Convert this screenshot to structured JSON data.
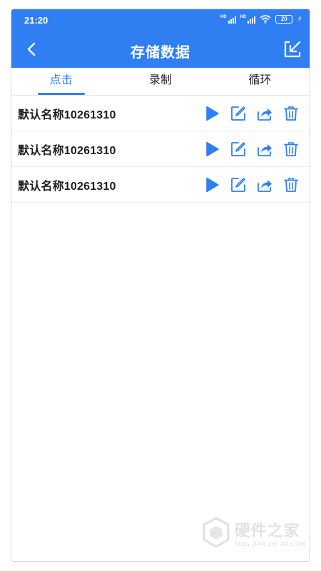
{
  "status_bar": {
    "time": "21:20",
    "battery": "20",
    "icons": [
      "hd-signal-icon",
      "hd-signal-icon",
      "wifi-icon",
      "battery-icon",
      "charging-icon"
    ]
  },
  "header": {
    "title": "存储数据",
    "back_icon": "chevron-left-icon",
    "action_icon": "import-arrow-icon"
  },
  "tabs": [
    {
      "label": "点击",
      "active": true
    },
    {
      "label": "录制",
      "active": false
    },
    {
      "label": "循环",
      "active": false
    }
  ],
  "records": [
    {
      "name": "默认名称10261310"
    },
    {
      "name": "默认名称10261310"
    },
    {
      "name": "默认名称10261310"
    }
  ],
  "row_actions": [
    "play-icon",
    "edit-icon",
    "share-icon",
    "delete-icon"
  ],
  "watermark": {
    "name": "硬件之家",
    "url": "YING JIAN ZHI JIA.COM"
  },
  "colors": {
    "primary": "#2f7ff2",
    "text": "#1e1e1e",
    "divider": "#ececec"
  }
}
